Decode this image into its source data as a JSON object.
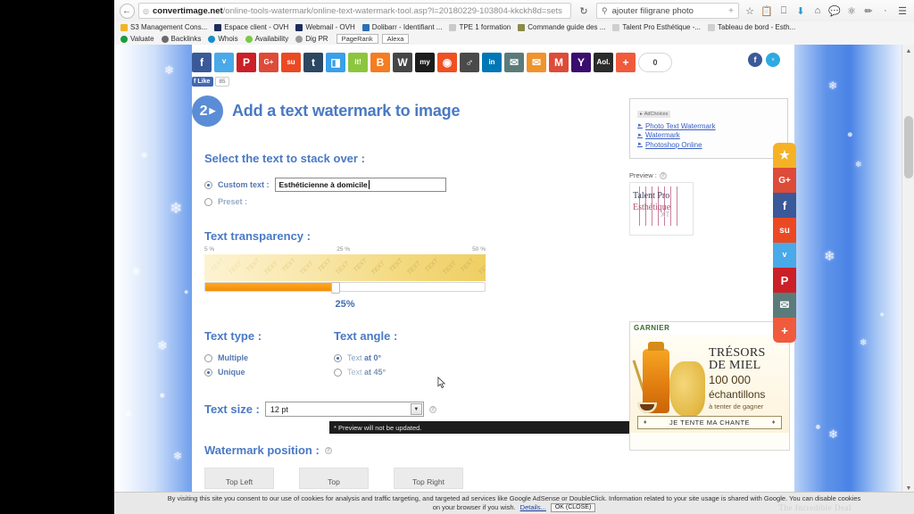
{
  "browser": {
    "back_icon": "back-arrow",
    "url_shield_icon": "shield-icon",
    "url_host": "convertimage.net",
    "url_path": "/online-tools-watermark/online-text-watermark-tool.asp?l=20180229-103804-kkckh8d=sets",
    "reload_icon": "reload-icon",
    "search_value": "ajouter filigrane photo",
    "search_icon": "search-icon",
    "search_plus": "+",
    "toolbar_icons": [
      "star-icon",
      "clipboard-icon",
      "pocket-icon",
      "download-icon",
      "home-icon",
      "chat-icon",
      "palette-icon",
      "eyedropper-icon",
      "dash-icon",
      "hamburger-menu-icon"
    ],
    "bookmarks_row1": [
      {
        "label": "S3 Management Cons...",
        "color": "#f0b429"
      },
      {
        "label": "Espace client - OVH",
        "color": "#1d2d5c"
      },
      {
        "label": "Webmail - OVH",
        "color": "#1d2d5c"
      },
      {
        "label": "Dolibarr - Identifiant ...",
        "color": "#2c6fb5"
      },
      {
        "label": "TPE 1 formation",
        "color": "#c9c9c9"
      },
      {
        "label": "Commande guide des ...",
        "color": "#8a8a4a"
      },
      {
        "label": "Talent Pro Esthétique -...",
        "color": "#cfcfcf"
      },
      {
        "label": "Tableau de bord - Esth...",
        "color": "#cfcfcf"
      }
    ],
    "bookmarks_row2": [
      {
        "label": "Valuate",
        "color": "#1a9c3c"
      },
      {
        "label": "Backlinks",
        "color": "#6b6b6b"
      },
      {
        "label": "Whois",
        "color": "#1b8dc4"
      },
      {
        "label": "Availability",
        "color": "#7ac943"
      },
      {
        "label": "Dig PR",
        "color": "#9a9a9a"
      }
    ],
    "bookmarks_boxes": [
      "PageRank",
      "Alexa"
    ]
  },
  "share_top": {
    "buttons": [
      {
        "name": "facebook",
        "glyph": "f",
        "color": "#3b5998"
      },
      {
        "name": "twitter",
        "glyph": "ᵛ",
        "color": "#4aa9e8"
      },
      {
        "name": "pinterest",
        "glyph": "P",
        "color": "#cb2027"
      },
      {
        "name": "google-plus",
        "glyph": "G+",
        "color": "#dd4b39"
      },
      {
        "name": "stumbleupon",
        "glyph": "su",
        "color": "#eb4924"
      },
      {
        "name": "tumblr",
        "glyph": "t",
        "color": "#2c4762"
      },
      {
        "name": "diigo",
        "glyph": "◨",
        "color": "#3aa0e8"
      },
      {
        "name": "instapaper",
        "glyph": "it!",
        "color": "#8cc63e"
      },
      {
        "name": "blogger",
        "glyph": "B",
        "color": "#f57c20"
      },
      {
        "name": "wordpress",
        "glyph": "W",
        "color": "#464646"
      },
      {
        "name": "myspace",
        "glyph": "my",
        "color": "#1c1c1c"
      },
      {
        "name": "reddit",
        "glyph": "◉",
        "color": "#ef5124"
      },
      {
        "name": "mars",
        "glyph": "♂",
        "color": "#4a4a4a"
      },
      {
        "name": "linkedin",
        "glyph": "in",
        "color": "#0077b5"
      },
      {
        "name": "email",
        "glyph": "✉",
        "color": "#5b7b7b"
      },
      {
        "name": "mail2",
        "glyph": "✉",
        "color": "#f0932b"
      },
      {
        "name": "gmail",
        "glyph": "M",
        "color": "#dd4b39"
      },
      {
        "name": "yahoo",
        "glyph": "Y",
        "color": "#3b0d6e"
      },
      {
        "name": "aol",
        "glyph": "Aol.",
        "color": "#2b2b2b"
      },
      {
        "name": "more",
        "glyph": "+",
        "color": "#ef5b3c"
      }
    ],
    "count": "0",
    "fb_like_label": "Like",
    "fb_like_count": "85"
  },
  "heading": {
    "step_number": "2",
    "step_arrow": "▶",
    "title": "Add a text watermark to image"
  },
  "form": {
    "select_text_title": "Select the text to stack over :",
    "custom_text_label": "Custom text :",
    "custom_text_value": "Esthéticienne à domicile",
    "preset_label": "Preset :",
    "transparency_title": "Text transparency :",
    "transparency_min": "5 %",
    "transparency_mid": "25 %",
    "transparency_max": "50 %",
    "transparency_value": "25%",
    "band_word": "TEXT",
    "text_type_title": "Text type :",
    "text_type_options": [
      "Multiple",
      "Unique"
    ],
    "text_type_selected": "Unique",
    "text_angle_title": "Text angle :",
    "text_angle_options": [
      "Text at 0°",
      "Text at 45°"
    ],
    "text_angle_selected": "Text at 0°",
    "angle_prefix": "Text ",
    "angle_0_bold": "at 0°",
    "angle_45_bold": "at 45°",
    "text_size_title": "Text size :",
    "text_size_value": "12 pt",
    "text_size_arrow": "▼",
    "tooltip": "* Preview will not be updated.",
    "watermark_position_title": "Watermark position :",
    "position_buttons": [
      "Top Left",
      "Top",
      "Top Right"
    ]
  },
  "sidebar": {
    "adchoices": "AdChoices",
    "ad_links": [
      "Photo Text Watermark",
      "Watermark",
      "Photoshop Online"
    ],
    "preview_label": "Preview :",
    "preview_logo_line1": "Talent Pro",
    "preview_logo_line2": "Esthétique",
    "preview_watermark": "XT"
  },
  "garnier_ad": {
    "brand": "GARNIER",
    "adx_icon": "adchoices-icon",
    "headline_line1": "TRÉSORS",
    "headline_line2": "DE MIEL",
    "big_number": "100 000",
    "subline": "échantillons",
    "tagline": "à tenter de gagner",
    "cta": "JE TENTE MA CHANTE"
  },
  "vertical_share": {
    "buttons": [
      {
        "name": "favorite",
        "glyph": "★",
        "color": "#f5b227"
      },
      {
        "name": "google-plus",
        "glyph": "G+",
        "color": "#dd4b39"
      },
      {
        "name": "facebook",
        "glyph": "f",
        "color": "#3b5998"
      },
      {
        "name": "stumbleupon",
        "glyph": "su",
        "color": "#eb4924"
      },
      {
        "name": "twitter",
        "glyph": "ᵛ",
        "color": "#4aa9e8"
      },
      {
        "name": "pinterest",
        "glyph": "P",
        "color": "#cb2027"
      },
      {
        "name": "email",
        "glyph": "✉",
        "color": "#5b7b7b"
      },
      {
        "name": "more",
        "glyph": "+",
        "color": "#ef5b3c"
      }
    ],
    "float_twitter": "ᵛ",
    "float_facebook": "f"
  },
  "cookie": {
    "line1_a": "By visiting this site you consent to our use of cookies for analysis and traffic targeting, and targeted ad services like Google AdSense or DoubleClick. Information related to your site usage is shared with Google. You can disable cookies",
    "line2_a": "on your browser if you wish.",
    "details": "Details...",
    "ok_button": "OK (CLOSE)",
    "watermark_text": "The Incredible Deal"
  },
  "colors": {
    "accent_blue": "#4a79c4",
    "step_circle": "#5b8dd6",
    "slider_orange": "#f58f06",
    "band_yellow": "#f3d97f"
  }
}
